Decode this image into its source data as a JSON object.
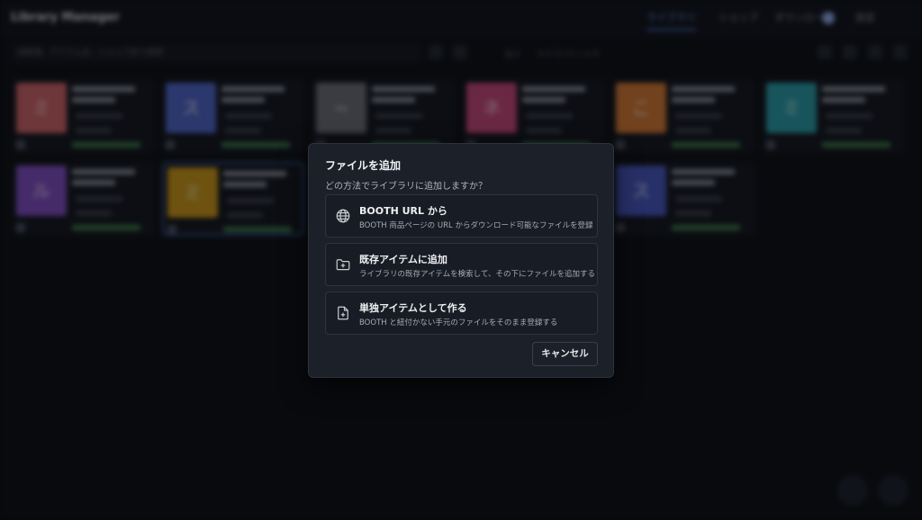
{
  "app": {
    "title": "Library Manager",
    "nav_tabs": [
      "ライブラリ",
      "ショップ",
      "ダウンロード",
      "設定"
    ],
    "search_placeholder": "検索後、アイテム名、ショップ名で検索",
    "toolbar_labels": [
      "並び",
      "カテゴリ",
      "フィルタ"
    ],
    "cards": [
      {
        "thumb": "ミ",
        "color": "#c9646a"
      },
      {
        "thumb": "ス",
        "color": "#4f66c6"
      },
      {
        "thumb": "~",
        "color": "#6a6e78"
      },
      {
        "thumb": "ネ",
        "color": "#c1497a"
      },
      {
        "thumb": "こ",
        "color": "#d07838"
      },
      {
        "thumb": "ミ",
        "color": "#2d9aa8"
      },
      {
        "thumb": "ル",
        "color": "#7f4fc0"
      },
      {
        "thumb": "ミ",
        "color": "#c8961e"
      },
      {
        "thumb": "ス",
        "color": "#4958c0"
      }
    ]
  },
  "dialog": {
    "title": "ファイルを追加",
    "subtitle": "どの方法でライブラリに追加しますか？",
    "options": [
      {
        "icon": "globe-icon",
        "title": "BOOTH URL から",
        "desc": "BOOTH 商品ページの URL からダウンロード可能なファイルを登録"
      },
      {
        "icon": "folder-plus-icon",
        "title": "既存アイテムに追加",
        "desc": "ライブラリの既存アイテムを検索して、その下にファイルを追加する"
      },
      {
        "icon": "file-plus-icon",
        "title": "単独アイテムとして作る",
        "desc": "BOOTH と紐付かない手元のファイルをそのまま登録する"
      }
    ],
    "cancel_label": "キャンセル"
  }
}
